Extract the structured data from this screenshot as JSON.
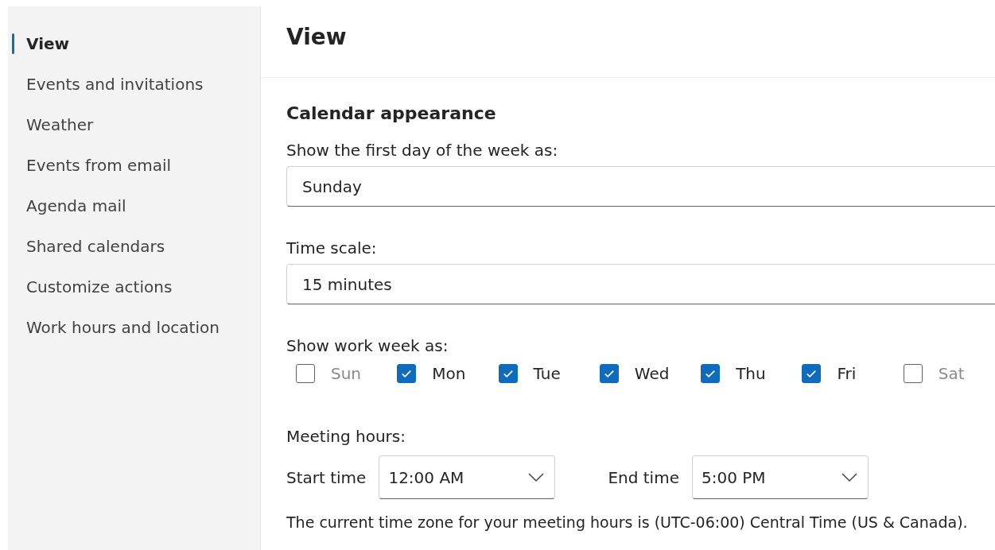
{
  "sidebar": {
    "items": [
      {
        "label": "View",
        "selected": true
      },
      {
        "label": "Events and invitations",
        "selected": false
      },
      {
        "label": "Weather",
        "selected": false
      },
      {
        "label": "Events from email",
        "selected": false
      },
      {
        "label": "Agenda mail",
        "selected": false
      },
      {
        "label": "Shared calendars",
        "selected": false
      },
      {
        "label": "Customize actions",
        "selected": false
      },
      {
        "label": "Work hours and location",
        "selected": false
      }
    ]
  },
  "main": {
    "title": "View",
    "section": "Calendar appearance",
    "first_day": {
      "label": "Show the first day of the week as:",
      "value": "Sunday"
    },
    "time_scale": {
      "label": "Time scale:",
      "value": "15 minutes"
    },
    "work_week": {
      "label": "Show work week as:",
      "days": [
        {
          "label": "Sun",
          "checked": false
        },
        {
          "label": "Mon",
          "checked": true
        },
        {
          "label": "Tue",
          "checked": true
        },
        {
          "label": "Wed",
          "checked": true
        },
        {
          "label": "Thu",
          "checked": true
        },
        {
          "label": "Fri",
          "checked": true
        },
        {
          "label": "Sat",
          "checked": false
        }
      ]
    },
    "meeting_hours": {
      "label": "Meeting hours:",
      "start": {
        "label": "Start time",
        "value": "12:00 AM"
      },
      "end": {
        "label": "End time",
        "value": "5:00 PM"
      }
    },
    "time_zone_note": "The current time zone for your meeting hours is (UTC-06:00) Central Time (US & Canada)."
  }
}
